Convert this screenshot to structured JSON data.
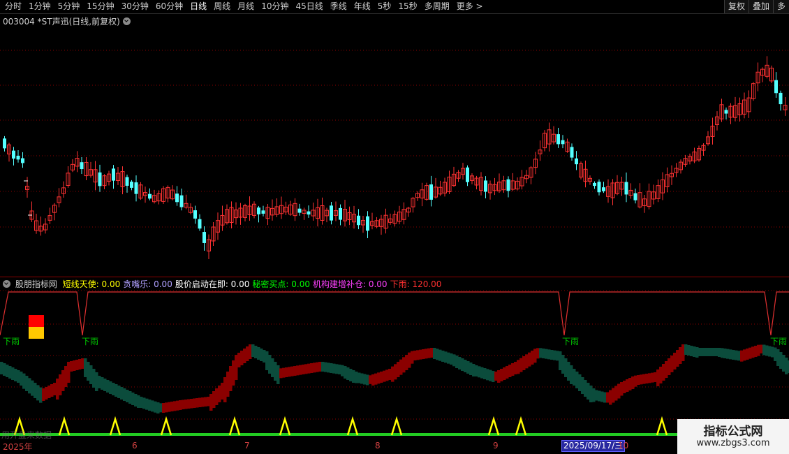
{
  "toolbar": {
    "tabs": [
      "分时",
      "1分钟",
      "5分钟",
      "15分钟",
      "30分钟",
      "60分钟",
      "日线",
      "周线",
      "月线",
      "10分钟",
      "45日线",
      "季线",
      "年线",
      "5秒",
      "15秒",
      "多周期",
      "更多 >"
    ],
    "active_tab": "日线",
    "right_buttons": [
      "复权",
      "叠加",
      "多"
    ]
  },
  "main_title": "003004 *ST声迅(日线,前复权)",
  "indicator": {
    "name": "股朋指标网",
    "values": [
      {
        "label": "短线天使: 0.00",
        "color": "#ffff00"
      },
      {
        "label": "贪嘴乐: 0.00",
        "color": "#b0a0ff"
      },
      {
        "label": "股价启动在即: 0.00",
        "color": "#ffffff"
      },
      {
        "label": "秘密买点: 0.00",
        "color": "#00ff00"
      },
      {
        "label": "机构建增补仓: 0.00",
        "color": "#ff40ff"
      },
      {
        "label": "下雨: 120.00",
        "color": "#ff3030"
      }
    ],
    "rain_label": "下雨"
  },
  "source_label": "用开盘来数据",
  "time_axis": {
    "labels": [
      "2025年",
      "6",
      "7",
      "8",
      "9",
      "10"
    ],
    "cursor_date": "2025/09/17/三"
  },
  "brand": {
    "name": "指标公式网",
    "url": "www.zbgs3.com"
  },
  "colors": {
    "up": "#ff3232",
    "down": "#54ffff",
    "grid": "#8b0000",
    "green_band": "#0a4a3a",
    "red_band": "#8b0000",
    "signal": "#ffff00"
  }
}
